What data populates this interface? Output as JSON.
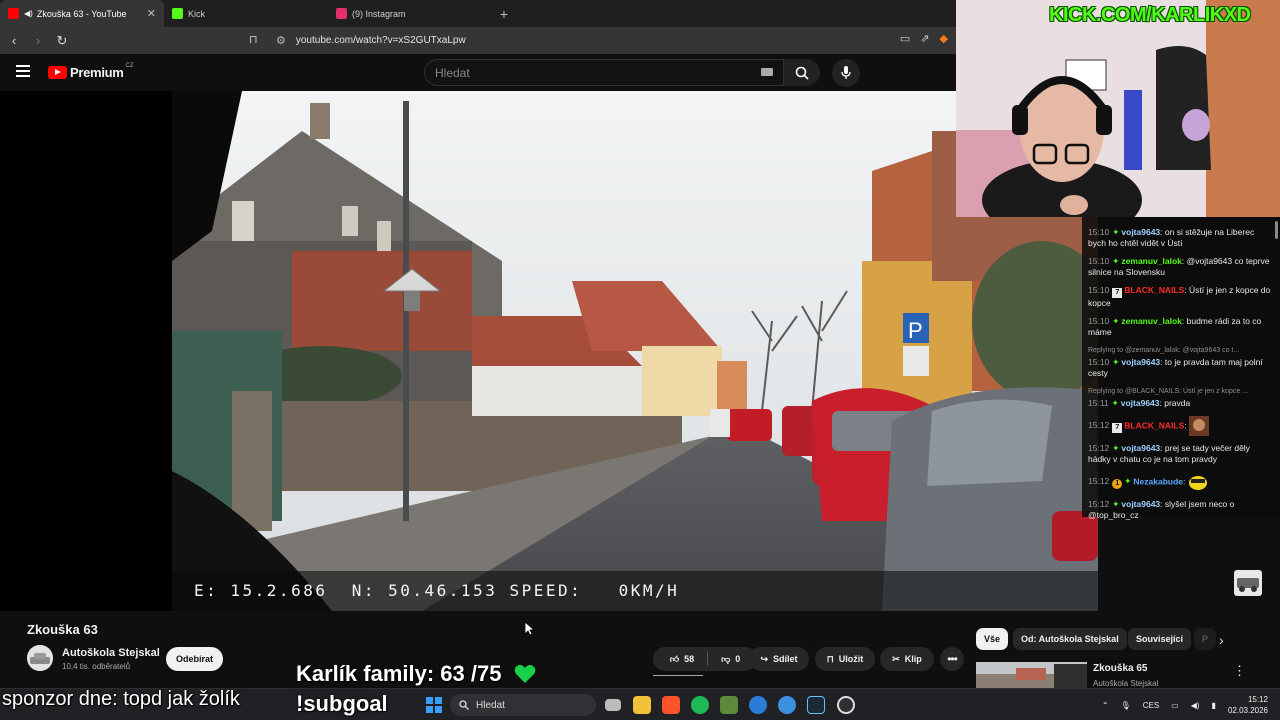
{
  "browser": {
    "tabs": [
      {
        "title": "Zkouška 63 - YouTube",
        "active": true,
        "favicon_color": "#ff0000"
      },
      {
        "title": "Kick",
        "active": false,
        "favicon_color": "#53fc18"
      },
      {
        "title": "(9) Instagram",
        "active": false,
        "favicon_color": "#e1306c"
      }
    ],
    "new_tab_label": "+",
    "close_label": "✕",
    "url": "youtube.com/watch?v=xS2GUTxaLpw"
  },
  "youtube": {
    "logo_text": "Premium",
    "logo_region": "CZ",
    "search_placeholder": "Hledat",
    "video": {
      "hud_text": "E: 15.2.686  N: 50.46.153 SPEED:   0KM/H",
      "title": "Zkouška 63",
      "channel": "Autoškola Stejskal",
      "subscribers": "10,4 tis. odběratelů",
      "subscribe_label": "Odebírat",
      "likes": "58",
      "dislikes": "0",
      "share_label": "Sdílet",
      "save_label": "Uložit",
      "clip_label": "Klip",
      "more_label": "•••"
    },
    "chips": [
      "Vše",
      "Od: Autoškola Stejskal",
      "Související",
      "P"
    ],
    "recommendation": {
      "title": "Zkouška 65",
      "channel": "Autoškola Stejskal",
      "more_label": "⋮"
    }
  },
  "overlay": {
    "kick_url": "KICK.COM/KARLIKXD",
    "family": "Karlík family: 63 /75",
    "subgoal": "!subgoal",
    "sponsor": "sponzor dne: topd jak žolík"
  },
  "chat": [
    {
      "time": "15:10",
      "badge": "star",
      "user": "vojta9643",
      "ucls": "u-vojta",
      "text": "on si stěžuje na Liberec bych ho chtěl vidět v Ústí"
    },
    {
      "time": "15:10",
      "badge": "star",
      "user": "zemanuv_lalok",
      "ucls": "u-zem",
      "text": "@vojta9643 co teprve silnice na Slovensku"
    },
    {
      "time": "15:10",
      "badge": "7tv",
      "user": "BLACK_NAILS",
      "ucls": "u-black",
      "text": "Ústí je jen z kopce do kopce"
    },
    {
      "time": "15:10",
      "badge": "star",
      "user": "zemanuv_lalok",
      "ucls": "u-zem",
      "text": "budme rádi za to co máme"
    },
    {
      "reply": "Replying to @zemanuv_lalok: @vojta9643 co t...",
      "time": "15:10",
      "badge": "star",
      "user": "vojta9643",
      "ucls": "u-vojta",
      "text": "to je pravda tam maj polní cesty"
    },
    {
      "reply": "Replying to @BLACK_NAILS: Ústí je jen z kopce ...",
      "time": "15:11",
      "badge": "star",
      "user": "vojta9643",
      "ucls": "u-vojta",
      "text": "pravda"
    },
    {
      "time": "15:12",
      "badge": "7tv",
      "user": "BLACK_NAILS",
      "ucls": "u-black",
      "text": "",
      "emote": "face"
    },
    {
      "time": "15:12",
      "badge": "star",
      "user": "vojta9643",
      "ucls": "u-vojta",
      "text": "prej se tady večer děly hádky v chatu co je na tom pravdy"
    },
    {
      "time": "15:12",
      "badge": "gift",
      "user": "Nezakabude",
      "ucls": "u-nez",
      "text": "",
      "emote": "pepe"
    },
    {
      "time": "15:12",
      "badge": "star",
      "user": "vojta9643",
      "ucls": "u-vojta",
      "text": "slyšel jsem neco o @top_bro_cz"
    }
  ],
  "taskbar": {
    "search_label": "Hledat",
    "lang": "CES",
    "time": "15:12",
    "date": "02.03.2026"
  }
}
